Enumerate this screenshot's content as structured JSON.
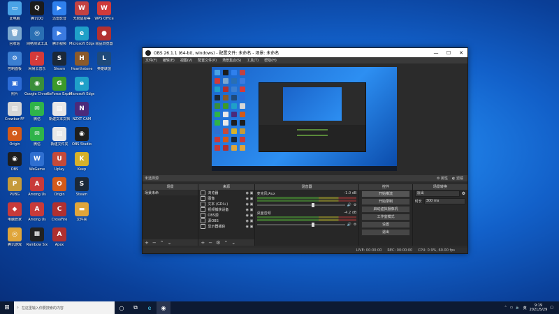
{
  "desktop": {
    "icons": [
      {
        "label": "此电脑",
        "color": "#4aa3e6",
        "glyph": "▭"
      },
      {
        "label": "腾讯QQ",
        "color": "#1b1b1b",
        "glyph": "Q"
      },
      {
        "label": "迅雷影音",
        "color": "#2f80ed",
        "glyph": "▶"
      },
      {
        "label": "无限鼠标等",
        "color": "#c24242",
        "glyph": "W"
      },
      {
        "label": "WPS Office",
        "color": "#d03a3a",
        "glyph": "W"
      },
      {
        "label": "回收站",
        "color": "#7aa7cf",
        "glyph": "🗑"
      },
      {
        "label": "网络测试工具",
        "color": "#2a6fb3",
        "glyph": "◎"
      },
      {
        "label": "腾讯视频",
        "color": "#3b7be0",
        "glyph": "▶"
      },
      {
        "label": "Microsoft Edge",
        "color": "#1fa0c8",
        "glyph": "e"
      },
      {
        "label": "极品浏览器",
        "color": "#b23030",
        "glyph": "●"
      },
      {
        "label": "控制面板",
        "color": "#3c7fd1",
        "glyph": "⚙"
      },
      {
        "label": "网易云音乐",
        "color": "#d53a3a",
        "glyph": "♪"
      },
      {
        "label": "Steam",
        "color": "#1b2838",
        "glyph": "S"
      },
      {
        "label": "Hearthstone",
        "color": "#8b5a2b",
        "glyph": "H"
      },
      {
        "label": "英雄联盟",
        "color": "#1f4a7a",
        "glyph": "L"
      },
      {
        "label": "照片",
        "color": "#2c6bd6",
        "glyph": "▣"
      },
      {
        "label": "Google Chrome",
        "color": "#3a8e3a",
        "glyph": "◉"
      },
      {
        "label": "GeForce Experience",
        "color": "#3c9a2a",
        "glyph": "G"
      },
      {
        "label": "Microsoft Edge",
        "color": "#1fa0c8",
        "glyph": "e"
      },
      {
        "label": "Crowbar-FF",
        "color": "#d6d6d6",
        "glyph": "▤"
      },
      {
        "label": "微信",
        "color": "#2fb34a",
        "glyph": "✉"
      },
      {
        "label": "新建文本文档",
        "color": "#e8e8e8",
        "glyph": "▤"
      },
      {
        "label": "NZXT CAM",
        "color": "#4b2a7a",
        "glyph": "N"
      },
      {
        "label": "Origin",
        "color": "#d35a1a",
        "glyph": "O"
      },
      {
        "label": "微信",
        "color": "#2fb34a",
        "glyph": "✉"
      },
      {
        "label": "新建文件夹",
        "color": "#e8e8e8",
        "glyph": "▤"
      },
      {
        "label": "OBS Studio",
        "color": "#1e1e1e",
        "glyph": "◉"
      },
      {
        "label": "OBS",
        "color": "#1e1e1e",
        "glyph": "◉"
      },
      {
        "label": "WeGame",
        "color": "#2f6fd0",
        "glyph": "W"
      },
      {
        "label": "Uplay",
        "color": "#c44a3a",
        "glyph": "U"
      },
      {
        "label": "Keep",
        "color": "#d6b12a",
        "glyph": "K"
      },
      {
        "label": "PUBG",
        "color": "#c59a3a",
        "glyph": "P"
      },
      {
        "label": "Among Us",
        "color": "#c83a3a",
        "glyph": "A"
      },
      {
        "label": "Origin",
        "color": "#d35a1a",
        "glyph": "O"
      },
      {
        "label": "Steam",
        "color": "#1b2838",
        "glyph": "S"
      },
      {
        "label": "电脑管家",
        "color": "#c83a3a",
        "glyph": "◆"
      },
      {
        "label": "Among Us",
        "color": "#c83a3a",
        "glyph": "A"
      },
      {
        "label": "CrossFire",
        "color": "#b03030",
        "glyph": "C"
      },
      {
        "label": "文件夹",
        "color": "#e0a53a",
        "glyph": "▬"
      },
      {
        "label": "腾讯游戏",
        "color": "#e0a53a",
        "glyph": "◎"
      },
      {
        "label": "Rainbow Six",
        "color": "#222",
        "glyph": "Ⅲ"
      },
      {
        "label": "Apex",
        "color": "#b03030",
        "glyph": "A"
      }
    ]
  },
  "obs": {
    "title": "OBS 26.1.1 (64-bit, windows) - 配置文件: 未命名 - 场景: 未命名",
    "window_buttons": {
      "min": "—",
      "max": "☐",
      "close": "✕"
    },
    "menu": [
      "文件(F)",
      "编辑(E)",
      "视图(V)",
      "配置文件(P)",
      "场景集合(S)",
      "工具(T)",
      "帮助(H)"
    ],
    "source_bar": {
      "label": "未选择源",
      "props": "属性",
      "filters": "滤镜"
    },
    "panels": {
      "scenes": {
        "title": "场景",
        "items": [
          "场景未命"
        ]
      },
      "sources": {
        "title": "来源",
        "items": [
          "浏览器",
          "图像",
          "文本 (GDI+)",
          "视频捕获设备",
          "OBS源",
          "源OBS",
          "显示器捕获"
        ]
      },
      "mixer": {
        "title": "混音器",
        "channels": [
          {
            "name": "麦克风/Aux",
            "db": "-1.0 dB",
            "level": 0.62
          },
          {
            "name": "桌面音频",
            "db": "-4.2 dB",
            "level": 0.62
          }
        ]
      },
      "transitions": {
        "title": "场景转换",
        "type": "淡出",
        "duration_label": "时长",
        "duration": "300 ms"
      },
      "controls": {
        "title": "控件",
        "buttons": [
          "开始推流",
          "开始录制",
          "启动虚拟摄像机",
          "工作室模式",
          "设置",
          "退出"
        ]
      }
    },
    "status": {
      "live": "LIVE: 00:00:00",
      "rec": "REC: 00:00:00",
      "cpu": "CPU: 0.9%, 60.00 fps"
    }
  },
  "taskbar": {
    "search_placeholder": "在这里输入你要搜索的内容",
    "time": "9:19",
    "date": "2021/5/29",
    "tray_ime": "英"
  }
}
